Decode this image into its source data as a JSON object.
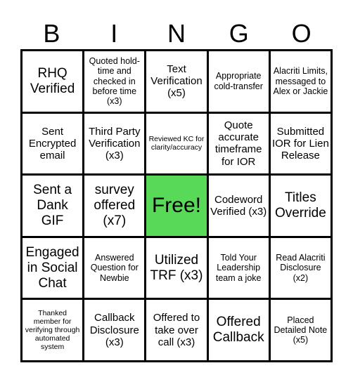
{
  "header": {
    "letters": [
      "B",
      "I",
      "N",
      "G",
      "O"
    ]
  },
  "colors": {
    "free_cell": "#59d958",
    "grid_line": "#000000",
    "cell_bg": "#ffffff"
  },
  "board": {
    "rows": [
      [
        "RHQ Verified",
        "Quoted hold-time and checked in before time (x3)",
        "Text Verification (x5)",
        "Appropriate cold-transfer",
        "Alacriti Limits, messaged to Alex or Jackie"
      ],
      [
        "Sent Encrypted email",
        "Third Party Verification (x3)",
        "Reviewed KC for clarity/accuracy",
        "Quote accurate timeframe for IOR",
        "Submitted IOR for Lien Release"
      ],
      [
        "Sent a Dank GIF",
        "survey offered (x7)",
        "Free!",
        "Codeword Verified (x3)",
        "Titles Override"
      ],
      [
        "Engaged in Social Chat",
        "Answered Question for Newbie",
        "Utilized TRF (x3)",
        "Told Your Leadership team a joke",
        "Read Alacriti Disclosure (x2)"
      ],
      [
        "Thanked member for verifying through automated system",
        "Callback Disclosure (x3)",
        "Offered to take over call (x3)",
        "Offered Callback",
        "Placed Detailed Note (x5)"
      ]
    ]
  }
}
